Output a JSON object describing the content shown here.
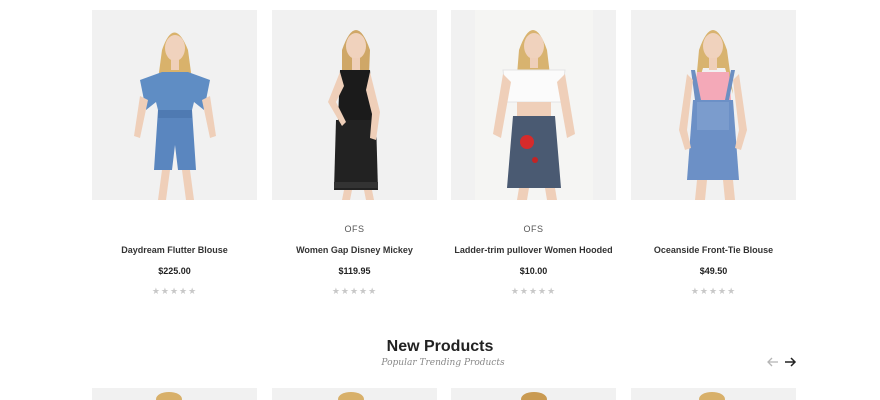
{
  "products": [
    {
      "vendor": "",
      "title": "Daydream Flutter Blouse",
      "price": "$225.00",
      "stars": "★★★★★",
      "image": "woman-denim-romper"
    },
    {
      "vendor": "OFS",
      "title": "Women Gap Disney Mickey",
      "price": "$119.95",
      "stars": "★★★★★",
      "image": "woman-black-lace-romper"
    },
    {
      "vendor": "OFS",
      "title": "Ladder-trim pullover Women Hooded",
      "price": "$10.00",
      "stars": "★★★★★",
      "image": "woman-white-top-denim-skirt"
    },
    {
      "vendor": "",
      "title": "Oceanside Front-Tie Blouse",
      "price": "$49.50",
      "stars": "★★★★★",
      "image": "woman-denim-overalls"
    }
  ],
  "new_products": {
    "title": "New Products",
    "subtitle": "Popular Trending Products",
    "prev_icon": "arrow-left-icon",
    "next_icon": "arrow-right-icon"
  },
  "colors": {
    "thumb_bg": "#f1f1f1",
    "star": "#c8c8c8",
    "text": "#222222"
  }
}
